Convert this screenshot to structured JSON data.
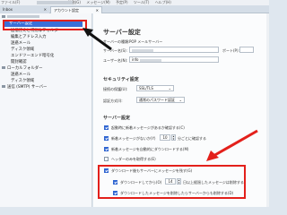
{
  "menubar": {
    "items": [
      "ファイル(F)",
      "編集(E)",
      "表示(V)",
      "移動(G)",
      "メッセージ(M)",
      "予定(P)",
      "ツール(T)",
      "ヘルプ(H)"
    ]
  },
  "tabs": [
    {
      "label": "Inbox",
      "active": false
    },
    {
      "label": "アカウント設定",
      "active": true
    }
  ],
  "sidebar": {
    "account_label": "",
    "items": [
      {
        "label": "サーバー設定",
        "selected": true,
        "level": 1
      },
      {
        "label": "送信控えと特別なフォルダー",
        "level": 1
      },
      {
        "label": "編集とアドレス入力",
        "level": 1
      },
      {
        "label": "迷惑メール",
        "level": 1
      },
      {
        "label": "ディスク領域",
        "level": 1
      },
      {
        "label": "エンドツーエンド暗号化",
        "level": 1
      },
      {
        "label": "開封確認",
        "level": 1
      },
      {
        "label": "ローカルフォルダー",
        "level": 0
      },
      {
        "label": "迷惑メール",
        "level": 1
      },
      {
        "label": "ディスク領域",
        "level": 1
      },
      {
        "label": "送信 (SMTP) サーバー",
        "level": 0
      }
    ]
  },
  "main": {
    "title": "サーバー設定",
    "server_type_label": "サーバーの種類:",
    "server_type_value": "POP メールサーバー",
    "server_name_label": "サーバー名(S):",
    "port_label": "ポート(P):",
    "user_name_label": "ユーザー名(N):",
    "user_name_prefix": "info",
    "security_heading": "セキュリティ設定",
    "connection_security_label": "接続の保護(U):",
    "connection_security_value": "SSL/TLS",
    "auth_label": "認証方式(I):",
    "auth_value": "通常のパスワード認証",
    "server_settings_heading": "サーバー設定",
    "check_on_startup": "起動時に新着メッセージがあるか確認する(C)",
    "check_every_prefix": "新着メッセージがないか(Y)",
    "check_every_value": "10",
    "check_every_suffix": "分ごとに確認する",
    "auto_download": "新着メッセージを自動的にダウンロードする(M)",
    "headers_only": "ヘッダーのみを取得する(E)",
    "leave_on_server": "ダウンロード後もサーバーにメッセージを残す(G)",
    "delete_after_prefix": "ダウンロードしてから(O)",
    "delete_after_value": "14",
    "delete_after_suffix": "日以上経過したメッセージは削除する",
    "delete_when_deleted": "ダウンロードしたメッセージを削除したらサーバーからも削除する(D)"
  },
  "colors": {
    "annotation": "#e3201b",
    "accent": "#2f65d1",
    "selection": "#3a6fd8"
  }
}
